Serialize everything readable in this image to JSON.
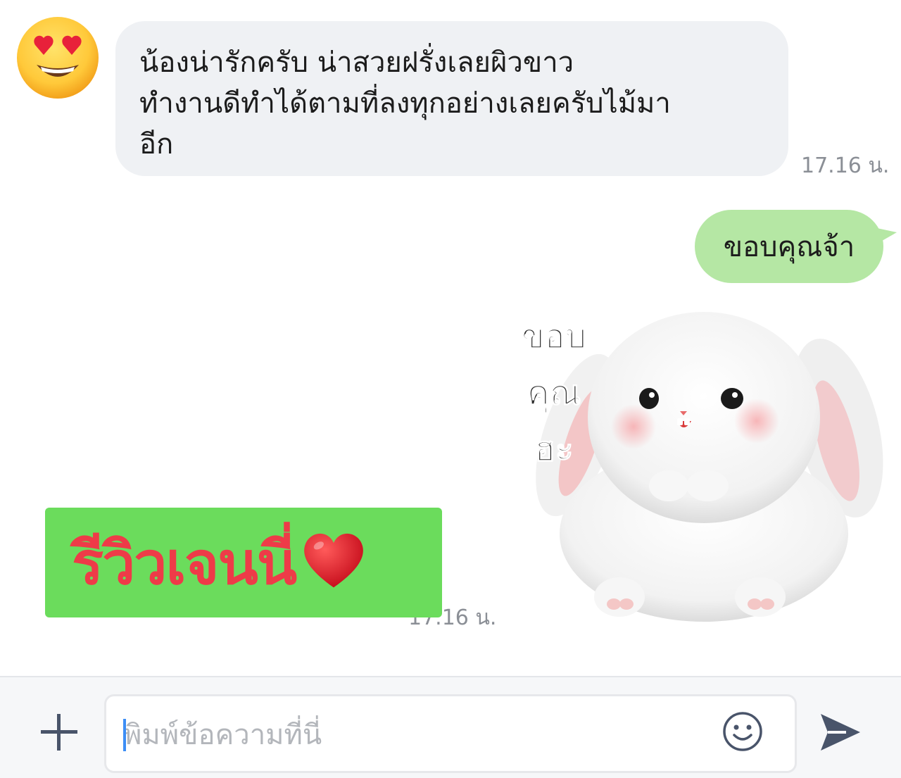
{
  "chat": {
    "incoming": {
      "avatar_icon": "heart-eyes-emoji-icon",
      "text": "น้องน่ารักครับ น่าสวยฝรั่งเลยผิวขาว\nทำงานดีทำได้ตามที่ลงทุกอย่างเลยครับไม้มา\nอีก",
      "time": "17.16 น."
    },
    "outgoing": {
      "text": "ขอบคุณจ้า",
      "color": "#b5e7a4"
    },
    "sticker": {
      "icon": "bunny-sticker-icon",
      "caption": "ขอบ\nคุณ\nฮะ",
      "time": "17.16 น."
    }
  },
  "overlay": {
    "review_label": "รีวิวเจนนี่",
    "heart_icon": "red-heart-icon",
    "background": "#6bdc5c",
    "text_color": "#ee3b48"
  },
  "composer": {
    "plus_icon": "plus-icon",
    "placeholder": "พิมพ์ข้อความที่นี่",
    "emoji_icon": "smiley-icon",
    "send_icon": "send-icon"
  }
}
